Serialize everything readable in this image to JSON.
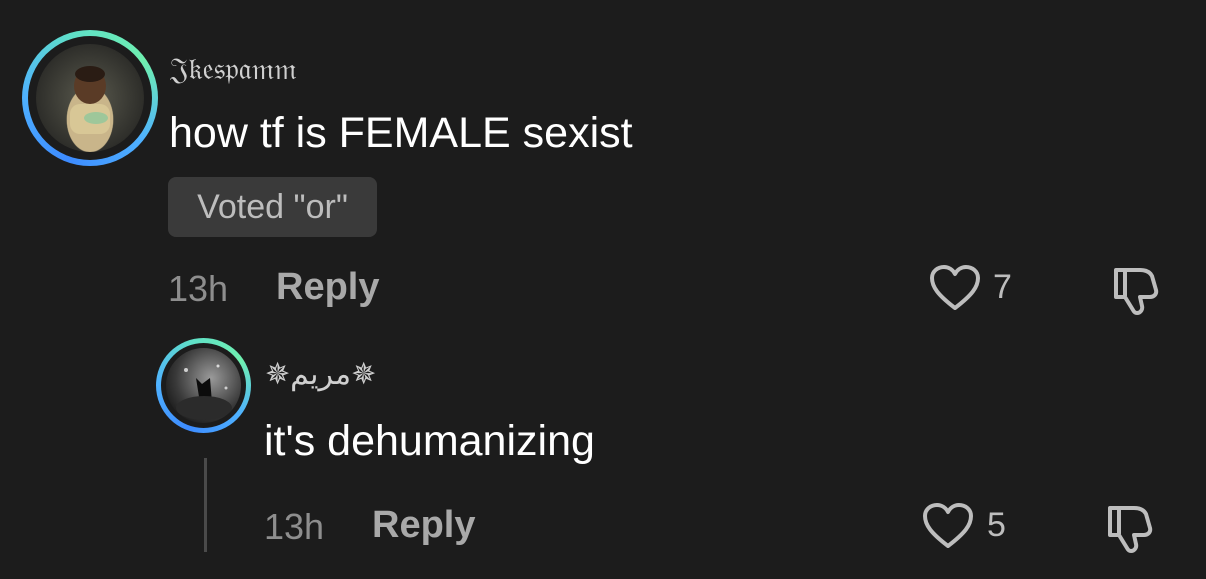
{
  "comments": [
    {
      "username": "𝔍𝔨𝔢𝔰𝔭𝔞𝔪𝔪",
      "text": "how tf is FEMALE sexist",
      "vote_badge": "Voted \"or\"",
      "time": "13h",
      "reply_label": "Reply",
      "like_count": "7",
      "avatar_icon": "avatar-photo-baby"
    },
    {
      "username": "✵مريم✵",
      "text": "it's dehumanizing",
      "time": "13h",
      "reply_label": "Reply",
      "like_count": "5",
      "avatar_icon": "avatar-photo-dark"
    }
  ],
  "colors": {
    "background": "#1c1c1c",
    "ring_blue": "#3d8bff",
    "ring_green": "#6ff0b0",
    "badge_bg": "#3a3a3a"
  }
}
